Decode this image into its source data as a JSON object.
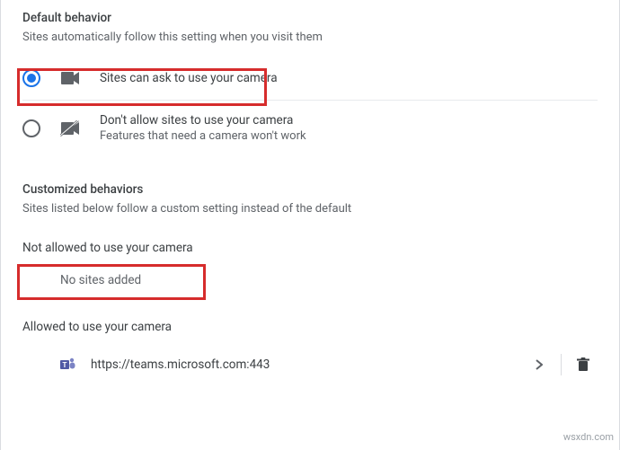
{
  "default_behavior": {
    "title": "Default behavior",
    "desc": "Sites automatically follow this setting when you visit them",
    "options": [
      {
        "label": "Sites can ask to use your camera",
        "sub": "",
        "selected": true,
        "icon": "camera-icon"
      },
      {
        "label": "Don't allow sites to use your camera",
        "sub": "Features that need a camera won't work",
        "selected": false,
        "icon": "camera-off-icon"
      }
    ]
  },
  "customized": {
    "title": "Customized behaviors",
    "desc": "Sites listed below follow a custom setting instead of the default",
    "not_allowed": {
      "title": "Not allowed to use your camera",
      "empty": "No sites added"
    },
    "allowed": {
      "title": "Allowed to use your camera",
      "sites": [
        {
          "url": "https://teams.microsoft.com:443",
          "icon": "teams-icon"
        }
      ]
    }
  },
  "watermark": "wsxdn.com"
}
